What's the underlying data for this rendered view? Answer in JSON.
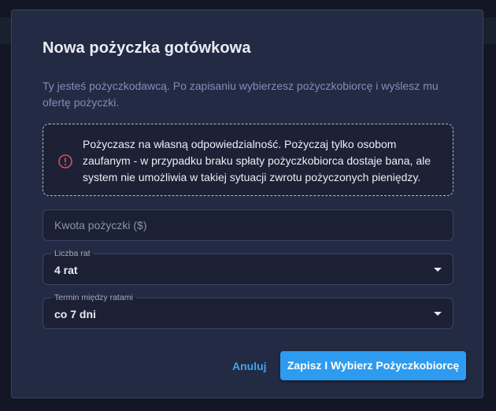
{
  "dialog": {
    "title": "Nowa pożyczka gotówkowa",
    "description": "Ty jesteś pożyczkodawcą. Po zapisaniu wybierzesz pożyczkobiorcę i wyślesz mu ofertę pożyczki.",
    "warning": {
      "icon": "exclamation-circle-icon",
      "text": "Pożyczasz na własną odpowiedzialność. Pożyczaj tylko osobom zaufanym - w przypadku braku spłaty pożyczkobiorca dostaje bana, ale system nie umożliwia w takiej sytuacji zwrotu pożyczonych pieniędzy."
    },
    "amount_field": {
      "placeholder": "Kwota pożyczki ($)",
      "value": ""
    },
    "installments_select": {
      "label": "Liczba rat",
      "value": "4 rat"
    },
    "interval_select": {
      "label": "Termin między ratami",
      "value": "co 7 dni"
    },
    "actions": {
      "cancel_label": "Anuluj",
      "submit_label": "Zapisz I Wybierz Pożyczkobiorcę"
    }
  },
  "colors": {
    "accent": "#2d9bf0",
    "warning_icon": "#e24b5b",
    "dialog_bg": "#232a43"
  }
}
